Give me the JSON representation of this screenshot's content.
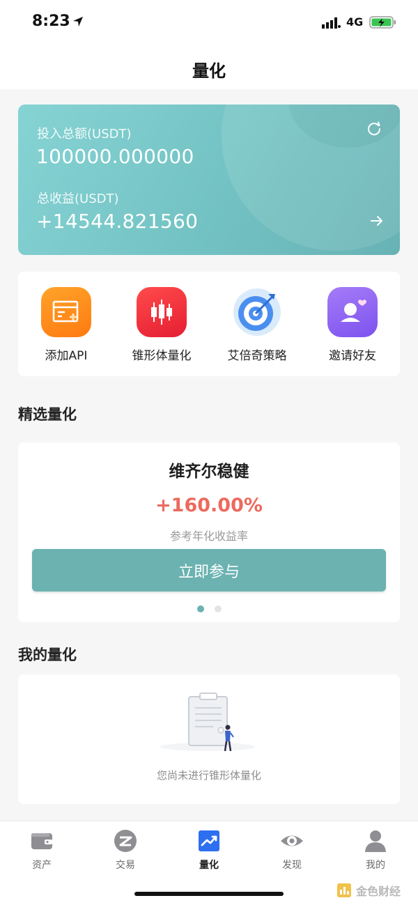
{
  "status_bar": {
    "time": "8:23",
    "network": "4G"
  },
  "nav": {
    "title": "量化"
  },
  "summary": {
    "invest_label": "投入总额(USDT)",
    "invest_value": "100000.000000",
    "profit_label": "总收益(USDT)",
    "profit_value": "+14544.821560",
    "gradient_start": "#86d3d4",
    "gradient_end": "#67b2b4"
  },
  "quick_actions": [
    {
      "label": "添加API",
      "icon": "api-card-icon",
      "color": "#ff8b1a"
    },
    {
      "label": "锥形体量化",
      "icon": "candlestick-icon",
      "color": "#f0313b"
    },
    {
      "label": "艾倍奇策略",
      "icon": "target-icon",
      "color": "#4a8ff0"
    },
    {
      "label": "邀请好友",
      "icon": "invite-friend-icon",
      "color": "#8d62f2"
    }
  ],
  "featured": {
    "section_title": "精选量化",
    "name": "维齐尔稳健",
    "rate": "+160.00%",
    "rate_label": "参考年化收益率",
    "button_label": "立即参与",
    "rate_color": "#ec6a5e",
    "button_color": "#6bb2b1",
    "carousel_total": 2,
    "carousel_active": 1
  },
  "my_quant": {
    "section_title": "我的量化",
    "empty_text": "您尚未进行锥形体量化"
  },
  "tabs": [
    {
      "label": "资产",
      "icon": "wallet-icon",
      "active": false
    },
    {
      "label": "交易",
      "icon": "exchange-icon",
      "active": false
    },
    {
      "label": "量化",
      "icon": "trend-chart-icon",
      "active": true
    },
    {
      "label": "发现",
      "icon": "eye-icon",
      "active": false
    },
    {
      "label": "我的",
      "icon": "profile-icon",
      "active": false
    }
  ],
  "watermark": {
    "text": "金色财经"
  }
}
